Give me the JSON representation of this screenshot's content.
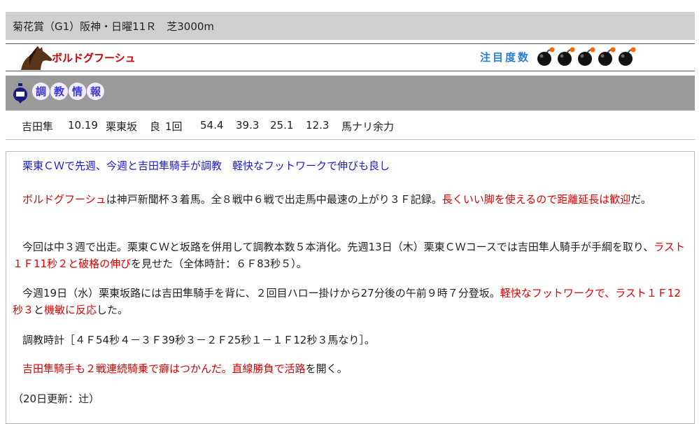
{
  "race": {
    "title": "菊花賞（G1）阪神・日曜11Ｒ　芝3000m"
  },
  "horse": {
    "name": "ボルドグフーシュ"
  },
  "attention": {
    "label": "注目度数",
    "bomb_count": 5,
    "bomb_color": "#111111",
    "fuse_color": "#ff6600"
  },
  "section": {
    "title_chars": [
      "調",
      "教",
      "情",
      "報"
    ]
  },
  "training": {
    "jockey": "吉田隼",
    "date": "10.19",
    "course": "栗東坂",
    "condition": "良",
    "times_label": "1回",
    "t1": "54.4",
    "t2": "39.3",
    "t3": "25.1",
    "t4": "12.3",
    "remark": "馬ナリ余力"
  },
  "comment": {
    "headline": "栗東ＣＷで先週、今週と吉田隼騎手が調教　軽快なフットワークで伸びも良し",
    "p1_horse": "ボルドグフーシュ",
    "p1_text": "は神戸新聞杯３着馬。全８戦中６戦で出走馬中最速の上がり３Ｆ記録。",
    "p1_red": "長くいい脚を使えるので距離延長は歓迎",
    "p1_end": "だ。",
    "p2_text": "今回は中３週で出走。栗東ＣＷと坂路を併用して調教本数５本消化。先週13日（木）栗東ＣＷコースでは吉田隼人騎手が手綱を取り、",
    "p2_red": "ラスト１Ｆ11秒２と破格の伸び",
    "p2_end": "を見せた（全体時計：６Ｆ83秒５）。",
    "p3_text": "今週19日（水）栗東坂路には吉田隼騎手を背に、２回目ハロー掛けから27分後の午前９時７分登坂。",
    "p3_red1": "軽快なフットワークで、ラスト１Ｆ12秒３",
    "p3_mid": "と",
    "p3_red2": "機敏に反応",
    "p3_end": "した。",
    "p4_text": "調教時計［４Ｆ54秒４－３Ｆ39秒３－２Ｆ25秒１－１Ｆ12秒３馬なり］。",
    "p5_red": "吉田隼騎手も２戦連続騎乗で癖はつかんだ。直線勝負で活路",
    "p5_end": "を開く。",
    "update": "（20日更新：辻）"
  }
}
